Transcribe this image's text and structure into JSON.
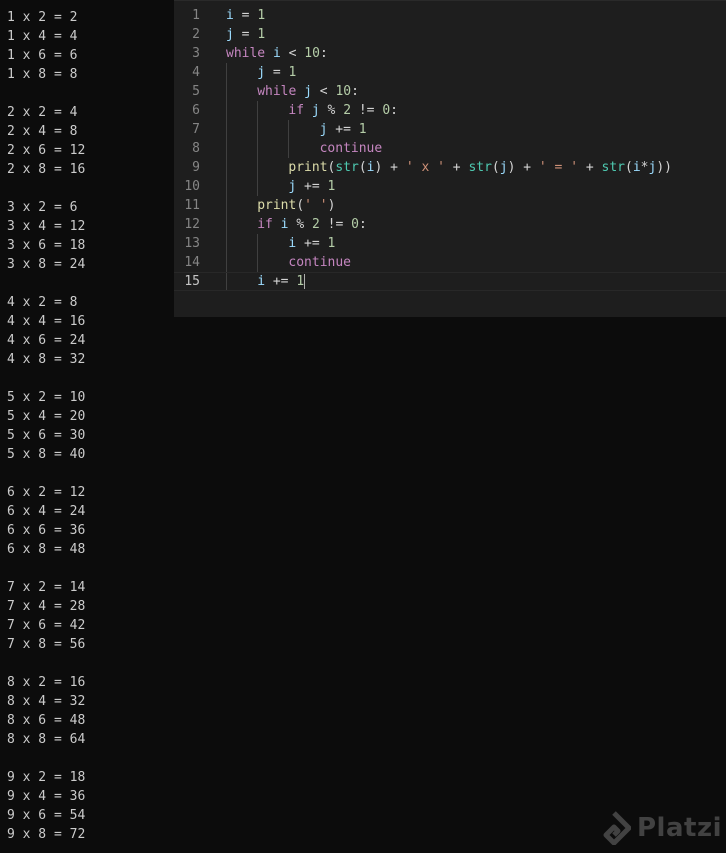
{
  "terminal": {
    "blocks": [
      [
        "1 x 2 = 2",
        "1 x 4 = 4",
        "1 x 6 = 6",
        "1 x 8 = 8"
      ],
      [
        "2 x 2 = 4",
        "2 x 4 = 8",
        "2 x 6 = 12",
        "2 x 8 = 16"
      ],
      [
        "3 x 2 = 6",
        "3 x 4 = 12",
        "3 x 6 = 18",
        "3 x 8 = 24"
      ],
      [
        "4 x 2 = 8",
        "4 x 4 = 16",
        "4 x 6 = 24",
        "4 x 8 = 32"
      ],
      [
        "5 x 2 = 10",
        "5 x 4 = 20",
        "5 x 6 = 30",
        "5 x 8 = 40"
      ],
      [
        "6 x 2 = 12",
        "6 x 4 = 24",
        "6 x 6 = 36",
        "6 x 8 = 48"
      ],
      [
        "7 x 2 = 14",
        "7 x 4 = 28",
        "7 x 6 = 42",
        "7 x 8 = 56"
      ],
      [
        "8 x 2 = 16",
        "8 x 4 = 32",
        "8 x 6 = 48",
        "8 x 8 = 64"
      ],
      [
        "9 x 2 = 18",
        "9 x 4 = 36",
        "9 x 6 = 54",
        "9 x 8 = 72"
      ]
    ]
  },
  "editor": {
    "current_line": 15,
    "lines": [
      {
        "n": "1",
        "indent": 0,
        "tokens": [
          [
            "var",
            "i"
          ],
          [
            "op",
            " = "
          ],
          [
            "num",
            "1"
          ]
        ]
      },
      {
        "n": "2",
        "indent": 0,
        "tokens": [
          [
            "var",
            "j"
          ],
          [
            "op",
            " = "
          ],
          [
            "num",
            "1"
          ]
        ]
      },
      {
        "n": "3",
        "indent": 0,
        "tokens": [
          [
            "kw",
            "while"
          ],
          [
            "op",
            " "
          ],
          [
            "var",
            "i"
          ],
          [
            "op",
            " < "
          ],
          [
            "num",
            "10"
          ],
          [
            "op",
            ":"
          ]
        ]
      },
      {
        "n": "4",
        "indent": 1,
        "tokens": [
          [
            "var",
            "j"
          ],
          [
            "op",
            " = "
          ],
          [
            "num",
            "1"
          ]
        ]
      },
      {
        "n": "5",
        "indent": 1,
        "tokens": [
          [
            "kw",
            "while"
          ],
          [
            "op",
            " "
          ],
          [
            "var",
            "j"
          ],
          [
            "op",
            " < "
          ],
          [
            "num",
            "10"
          ],
          [
            "op",
            ":"
          ]
        ]
      },
      {
        "n": "6",
        "indent": 2,
        "tokens": [
          [
            "kw",
            "if"
          ],
          [
            "op",
            " "
          ],
          [
            "var",
            "j"
          ],
          [
            "op",
            " % "
          ],
          [
            "num",
            "2"
          ],
          [
            "op",
            " != "
          ],
          [
            "num",
            "0"
          ],
          [
            "op",
            ":"
          ]
        ]
      },
      {
        "n": "7",
        "indent": 3,
        "tokens": [
          [
            "var",
            "j"
          ],
          [
            "op",
            " += "
          ],
          [
            "num",
            "1"
          ]
        ]
      },
      {
        "n": "8",
        "indent": 3,
        "tokens": [
          [
            "kw",
            "continue"
          ]
        ]
      },
      {
        "n": "9",
        "indent": 2,
        "tokens": [
          [
            "fn",
            "print"
          ],
          [
            "op",
            "("
          ],
          [
            "bi",
            "str"
          ],
          [
            "op",
            "("
          ],
          [
            "var",
            "i"
          ],
          [
            "op",
            ") + "
          ],
          [
            "str",
            "' x '"
          ],
          [
            "op",
            " + "
          ],
          [
            "bi",
            "str"
          ],
          [
            "op",
            "("
          ],
          [
            "var",
            "j"
          ],
          [
            "op",
            ") + "
          ],
          [
            "str",
            "' = '"
          ],
          [
            "op",
            " + "
          ],
          [
            "bi",
            "str"
          ],
          [
            "op",
            "("
          ],
          [
            "var",
            "i"
          ],
          [
            "op",
            "*"
          ],
          [
            "var",
            "j"
          ],
          [
            "op",
            "))"
          ]
        ]
      },
      {
        "n": "10",
        "indent": 2,
        "tokens": [
          [
            "var",
            "j"
          ],
          [
            "op",
            " += "
          ],
          [
            "num",
            "1"
          ]
        ]
      },
      {
        "n": "11",
        "indent": 1,
        "tokens": [
          [
            "fn",
            "print"
          ],
          [
            "op",
            "("
          ],
          [
            "str",
            "' '"
          ],
          [
            "op",
            ")"
          ]
        ]
      },
      {
        "n": "12",
        "indent": 1,
        "tokens": [
          [
            "kw",
            "if"
          ],
          [
            "op",
            " "
          ],
          [
            "var",
            "i"
          ],
          [
            "op",
            " % "
          ],
          [
            "num",
            "2"
          ],
          [
            "op",
            " != "
          ],
          [
            "num",
            "0"
          ],
          [
            "op",
            ":"
          ]
        ]
      },
      {
        "n": "13",
        "indent": 2,
        "tokens": [
          [
            "var",
            "i"
          ],
          [
            "op",
            " += "
          ],
          [
            "num",
            "1"
          ]
        ]
      },
      {
        "n": "14",
        "indent": 2,
        "tokens": [
          [
            "kw",
            "continue"
          ]
        ]
      },
      {
        "n": "15",
        "indent": 1,
        "tokens": [
          [
            "var",
            "i"
          ],
          [
            "op",
            " += "
          ],
          [
            "num",
            "1"
          ]
        ]
      }
    ]
  },
  "watermark": {
    "text": "Platzi",
    "icon": "platzi-logo-icon"
  }
}
